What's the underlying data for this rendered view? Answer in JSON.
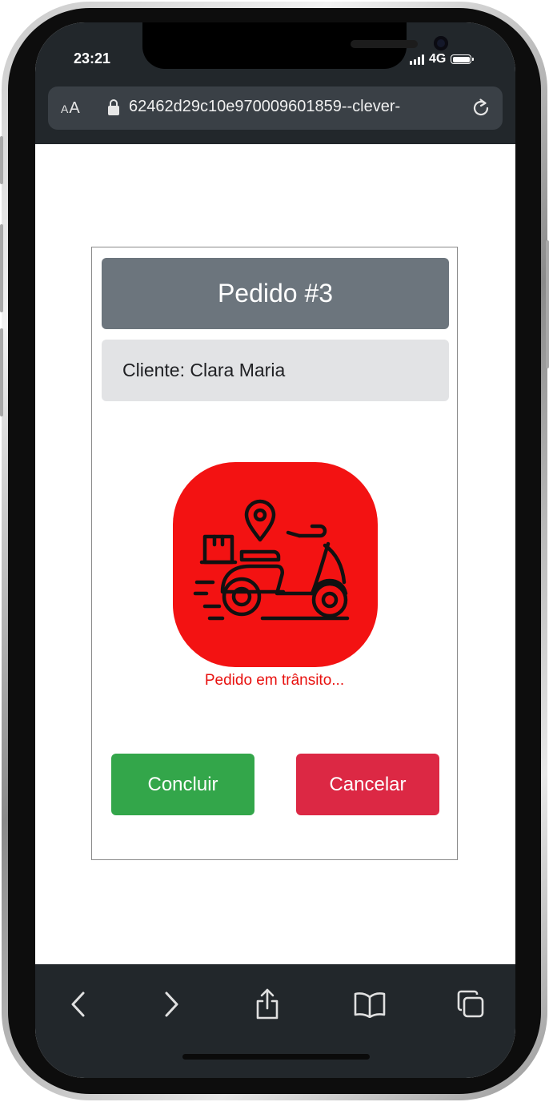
{
  "status_bar": {
    "time": "23:21",
    "network": "4G"
  },
  "browser": {
    "text_size_label_small": "A",
    "text_size_label_large": "A",
    "url": "62462d29c10e970009601859--clever-"
  },
  "order": {
    "title": "Pedido #3",
    "client_label": "Cliente:",
    "client_name": "Clara Maria",
    "status_icon": "scooter-delivery-icon",
    "status_text": "Pedido em trânsito...",
    "complete_label": "Concluir",
    "cancel_label": "Cancelar"
  },
  "toolbar": {
    "items": [
      "back-icon",
      "forward-icon",
      "share-icon",
      "bookmarks-icon",
      "tabs-icon"
    ]
  },
  "colors": {
    "header_bg": "#6c757d",
    "client_bg": "#e2e3e5",
    "status_red": "#e8110f",
    "success": "#33a64a",
    "danger": "#dc2844",
    "browser_chrome": "#22272b"
  }
}
